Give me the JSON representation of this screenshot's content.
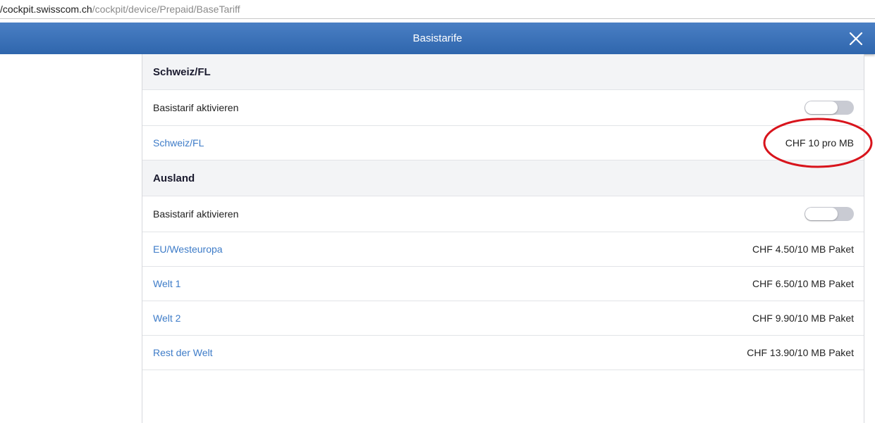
{
  "urlbar": {
    "host": "/cockpit.swisscom.ch",
    "path": "/cockpit/device/Prepaid/BaseTariff"
  },
  "header": {
    "title": "Basistarife",
    "close_icon": "close-icon"
  },
  "sections": {
    "domestic": {
      "heading": "Schweiz/FL",
      "toggle_label": "Basistarif aktivieren",
      "toggle_on": false,
      "rows": [
        {
          "label": "Schweiz/FL",
          "value": "CHF 10 pro MB"
        }
      ]
    },
    "abroad": {
      "heading": "Ausland",
      "toggle_label": "Basistarif aktivieren",
      "toggle_on": false,
      "rows": [
        {
          "label": "EU/Westeuropa",
          "value": "CHF 4.50/10 MB Paket"
        },
        {
          "label": "Welt 1",
          "value": "CHF 6.50/10 MB Paket"
        },
        {
          "label": "Welt 2",
          "value": "CHF 9.90/10 MB Paket"
        },
        {
          "label": "Rest der Welt",
          "value": "CHF 13.90/10 MB Paket"
        }
      ]
    }
  },
  "colors": {
    "header_blue": "#2f66ad",
    "link_blue": "#3e7cc8",
    "annotation_red": "#d8141c"
  }
}
